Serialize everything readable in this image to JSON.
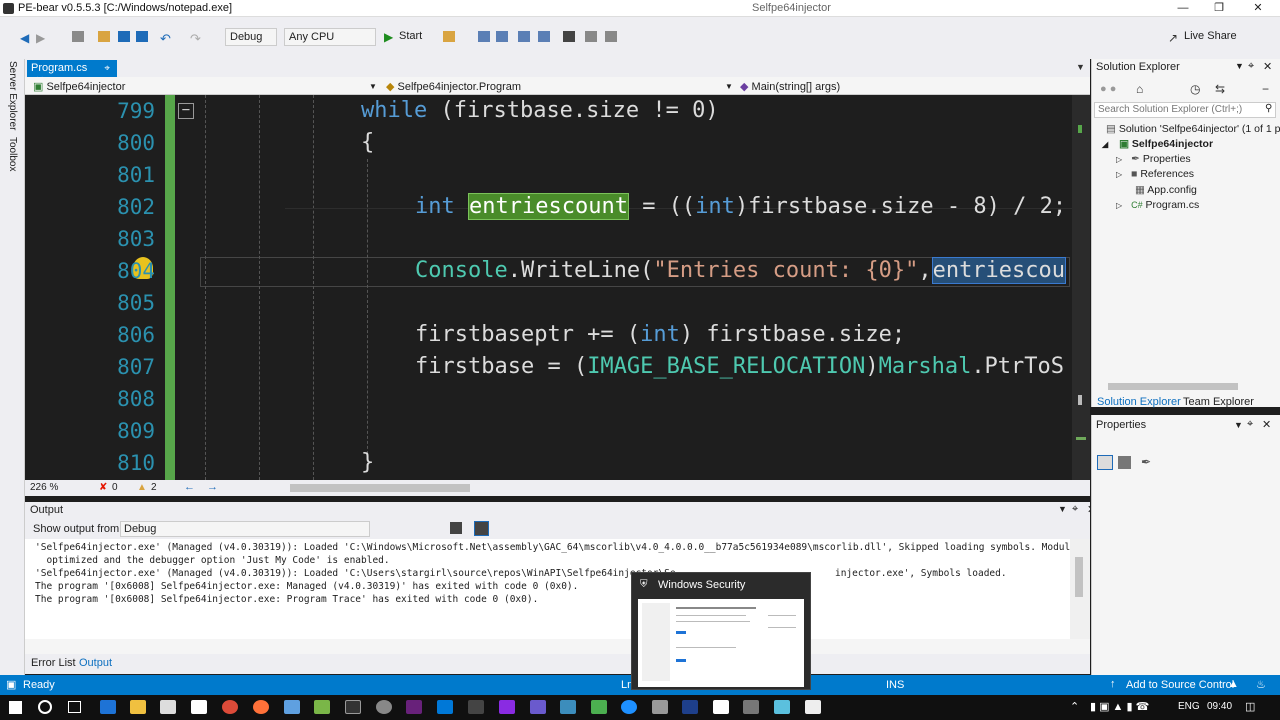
{
  "titlebar": {
    "title": "PE-bear v0.5.5.3 [C:/Windows/notepad.exe]",
    "right_text": "Selfpe64injector"
  },
  "toolbar": {
    "config": "Debug",
    "platform": "Any CPU",
    "start": "Start",
    "live_share": "Live Share"
  },
  "left_strip": {
    "server_explorer": "Server Explorer",
    "toolbox": "Toolbox"
  },
  "editor": {
    "tab": "Program.cs",
    "nav_project": "Selfpe64injector",
    "nav_class": "Selfpe64injector.Program",
    "nav_member": "Main(string[] args)",
    "lines": [
      {
        "num": "799",
        "text": "while (firstbase.size != 0)"
      },
      {
        "num": "800",
        "text": "{"
      },
      {
        "num": "801",
        "text": ""
      },
      {
        "num": "802",
        "text": "int entriescount = ((int)firstbase.size - 8) / 2;"
      },
      {
        "num": "803",
        "text": ""
      },
      {
        "num": "804",
        "text": "Console.WriteLine(\"Entries count: {0}\",entriescou"
      },
      {
        "num": "805",
        "text": ""
      },
      {
        "num": "806",
        "text": "firstbaseptr += (int) firstbase.size;"
      },
      {
        "num": "807",
        "text": "firstbase = (IMAGE_BASE_RELOCATION)Marshal.PtrToS"
      },
      {
        "num": "808",
        "text": ""
      },
      {
        "num": "809",
        "text": ""
      },
      {
        "num": "810",
        "text": "}"
      }
    ],
    "zoom": "226 %",
    "errors": "0",
    "warnings": "2"
  },
  "output": {
    "title": "Output",
    "show_from_label": "Show output from:",
    "source": "Debug",
    "lines": [
      "'Selfpe64injector.exe' (Managed (v4.0.30319)): Loaded 'C:\\Windows\\Microsoft.Net\\assembly\\GAC_64\\mscorlib\\v4.0_4.0.0.0__b77a5c561934e089\\mscorlib.dll', Skipped loading symbols. Module is",
      "  optimized and the debugger option 'Just My Code' is enabled.",
      "'Selfpe64injector.exe' (Managed (v4.0.30319)): Loaded 'C:\\Users\\stargirl\\source\\repos\\WinAPI\\Selfpe64injector\\Se",
      "The program '[0x6008] Selfpe64injector.exe: Managed (v4.0.30319)' has exited with code 0 (0x0).",
      "The program '[0x6008] Selfpe64injector.exe: Program Trace' has exited with code 0 (0x0)."
    ],
    "line3_tail": "injector.exe', Symbols loaded.",
    "tab_error_list": "Error List",
    "tab_output": "Output"
  },
  "solution_explorer": {
    "title": "Solution Explorer",
    "search_placeholder": "Search Solution Explorer (Ctrl+;)",
    "solution": "Solution 'Selfpe64injector' (1 of 1 p",
    "project": "Selfpe64injector",
    "items": [
      "Properties",
      "References",
      "App.config",
      "Program.cs"
    ],
    "tab_solution": "Solution Explorer",
    "tab_team": "Team Explorer"
  },
  "properties": {
    "title": "Properties"
  },
  "statusbar": {
    "ready": "Ready",
    "ln": "Ln",
    "ins": "INS",
    "source_control": "Add to Source Control"
  },
  "popup": {
    "title": "Windows Security"
  },
  "taskbar": {
    "lang": "ENG",
    "time": "09:40"
  },
  "colors": {
    "accent": "#007acc",
    "editor_bg": "#1e1e1e",
    "keyword": "#569cd6",
    "type": "#4ec9b0",
    "string": "#d69d85",
    "line_number": "#2b91af"
  }
}
